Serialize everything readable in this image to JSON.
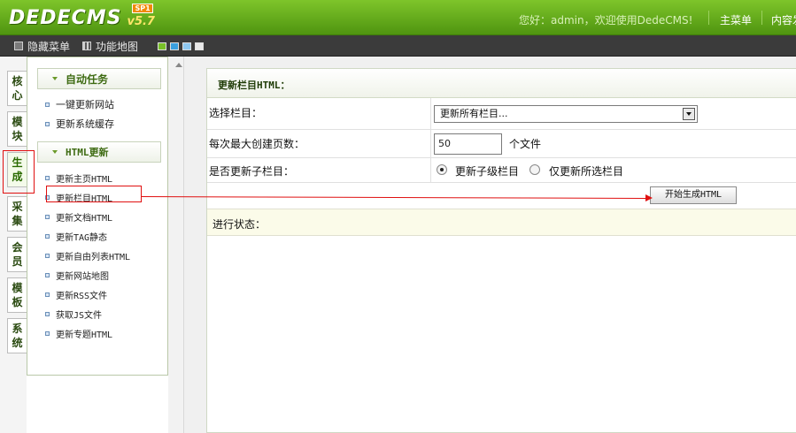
{
  "header": {
    "logo_text": "DEDECMS",
    "version": "v5.7",
    "sp": "SP1",
    "welcome": "您好：admin，欢迎使用DedeCMS!",
    "main_menu": "主菜单",
    "content_link": "内容发"
  },
  "toolbar": {
    "hide_menu": "隐藏菜单",
    "site_map": "功能地图"
  },
  "colors": {
    "header_green": "#5fa81a",
    "swatches": [
      "#78c028",
      "#3aa0e0",
      "#8fc8f0",
      "#e8e8e8"
    ]
  },
  "vtabs": [
    {
      "chars": [
        "核",
        "心"
      ]
    },
    {
      "chars": [
        "模",
        "块"
      ]
    },
    {
      "chars": [
        "生",
        "成"
      ],
      "active": true
    },
    {
      "chars": [
        "采",
        "集"
      ]
    },
    {
      "chars": [
        "会",
        "员"
      ]
    },
    {
      "chars": [
        "模",
        "板"
      ]
    },
    {
      "chars": [
        "系",
        "统"
      ]
    }
  ],
  "menu": {
    "section1": {
      "title": "自动任务",
      "items": [
        "一键更新网站",
        "更新系统缓存"
      ]
    },
    "section2": {
      "title": "HTML更新",
      "items": [
        "更新主页HTML",
        "更新栏目HTML",
        "更新文档HTML",
        "更新TAG静态",
        "更新自由列表HTML",
        "更新网站地图",
        "更新RSS文件",
        "获取JS文件",
        "更新专题HTML"
      ]
    }
  },
  "form": {
    "title": "更新栏目HTML：",
    "select_label": "选择栏目：",
    "select_value": "更新所有栏目...",
    "pages_label": "每次最大创建页数：",
    "pages_value": "50",
    "pages_unit": "个文件",
    "sub_label": "是否更新子栏目：",
    "radio_sub": "更新子级栏目",
    "radio_selected_only": "仅更新所选栏目",
    "start_button": "开始生成HTML",
    "status_label": "进行状态："
  }
}
